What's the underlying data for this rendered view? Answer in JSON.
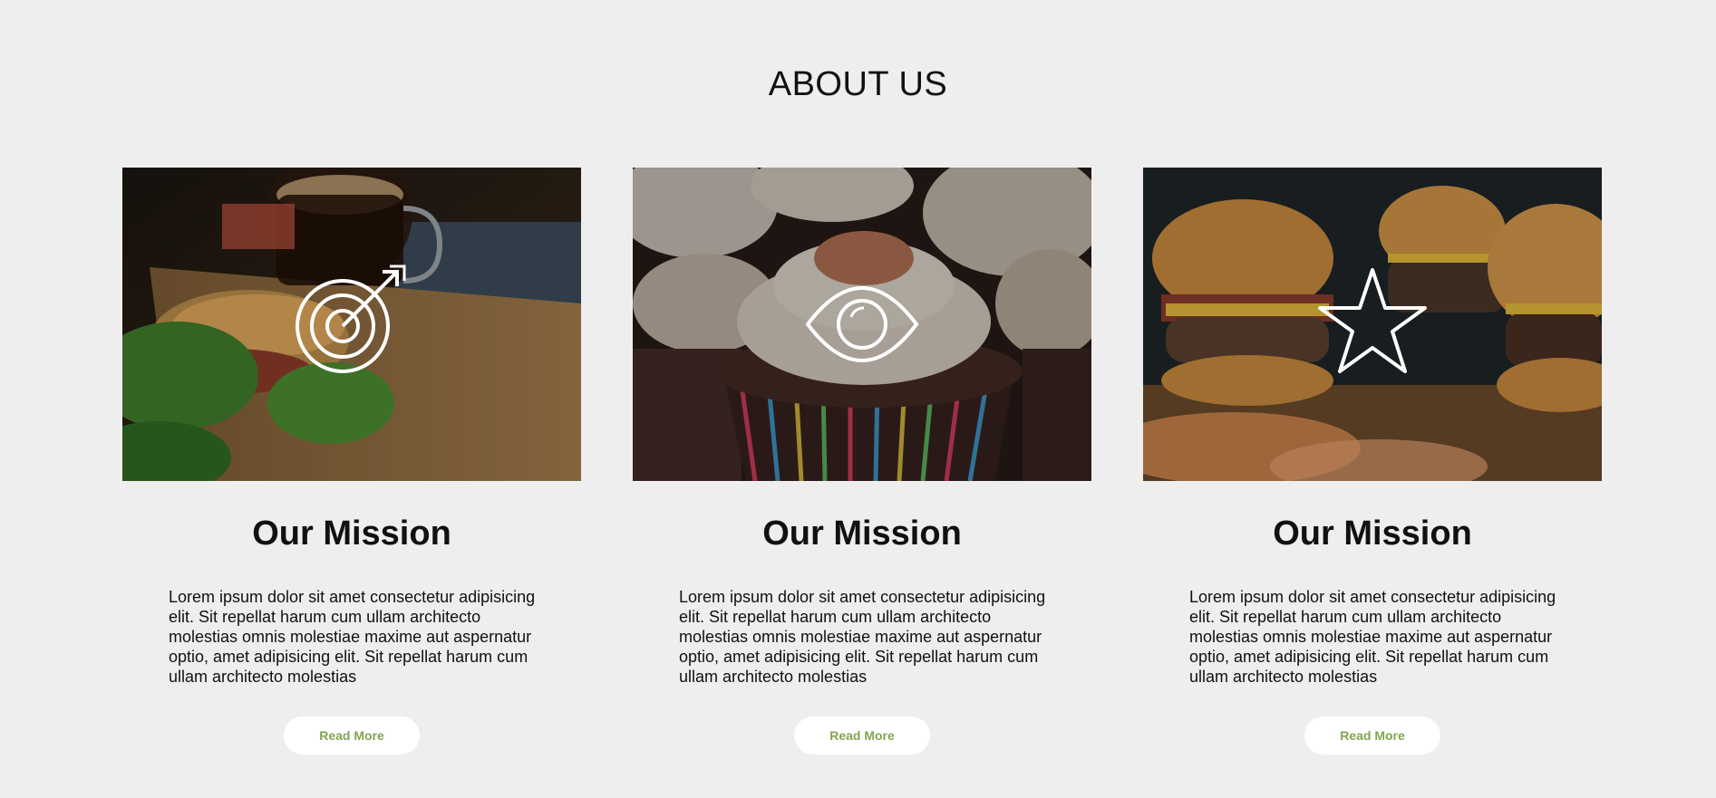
{
  "section": {
    "title": "ABOUT US"
  },
  "cards": [
    {
      "image": "coffee-sandwich-photo",
      "icon": "target-arrow-icon",
      "title": "Our Mission",
      "text": "Lorem ipsum dolor sit amet consectetur adipisicing elit. Sit repellat harum cum ullam architecto molestias omnis molestiae maxime aut aspernatur optio, amet adipisicing elit. Sit repellat harum cum ullam architecto molestias",
      "button": "Read More"
    },
    {
      "image": "cupcakes-photo",
      "icon": "eye-icon",
      "title": "Our Mission",
      "text": "Lorem ipsum dolor sit amet consectetur adipisicing elit. Sit repellat harum cum ullam architecto molestias omnis molestiae maxime aut aspernatur optio, amet adipisicing elit. Sit repellat harum cum ullam architecto molestias",
      "button": "Read More"
    },
    {
      "image": "burgers-photo",
      "icon": "star-icon",
      "title": "Our Mission",
      "text": "Lorem ipsum dolor sit amet consectetur adipisicing elit. Sit repellat harum cum ullam architecto molestias omnis molestiae maxime aut aspernatur optio, amet adipisicing elit. Sit repellat harum cum ullam architecto molestias",
      "button": "Read More"
    }
  ],
  "colors": {
    "background": "#eeeeee",
    "button_text": "#7fa650",
    "button_bg": "#ffffff"
  }
}
